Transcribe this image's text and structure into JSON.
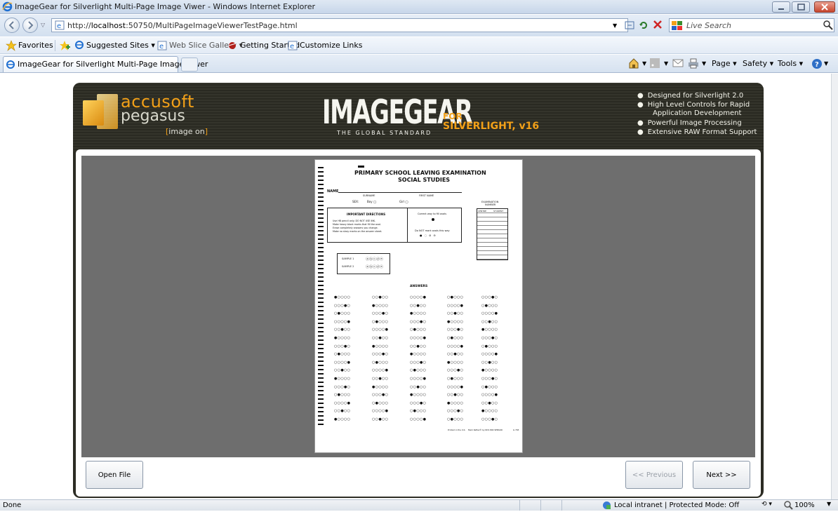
{
  "window": {
    "title": "ImageGear for Silverlight Multi-Page Image Viwer - Windows Internet Explorer"
  },
  "address_bar": {
    "url_prefix": "http://",
    "url_host": "localhost",
    "url_rest": ":50750/MultiPageImageViewerTestPage.html",
    "search_placeholder": "Live Search"
  },
  "favorites_bar": {
    "favorites": "Favorites",
    "suggested_sites": "Suggested Sites ▾",
    "web_slice_gallery": "Web Slice Gallery ▾",
    "getting_started": "Getting Started",
    "customize_links": "Customize Links"
  },
  "tab_bar": {
    "active_tab": "ImageGear for Silverlight Multi-Page Image Viwer",
    "page_menu": "Page ▾",
    "safety_menu": "Safety ▾",
    "tools_menu": "Tools ▾"
  },
  "banner": {
    "brand_accusoft": "accusoft",
    "brand_pegasus": "pegasus",
    "brand_tagline_open": "[",
    "brand_tagline": "image on",
    "brand_tagline_close": "]",
    "product": "IMAGEGEAR",
    "product_sub": "THE GLOBAL STANDARD",
    "for": "FOR",
    "platform": "SILVERLIGHT, v16",
    "features": [
      "Designed for Silverlight 2.0",
      "High Level Controls for Rapid",
      "Application Development",
      "Powerful Image Processing",
      "Extensive RAW Format Support"
    ]
  },
  "document": {
    "title1": "PRIMARY SCHOOL LEAVING EXAMINATION",
    "title2": "SOCIAL STUDIES",
    "name_label": "NAME",
    "surname_label": "SURNAME",
    "first_name_label": "FIRST NAME",
    "sex_label": "SEX:",
    "boy_label": "Boy ◯",
    "girl_label": "Girl ◯",
    "exam_number_1": "EXAMINATION",
    "exam_number_2": "NUMBER",
    "centre_label": "CENTRE",
    "student_label": "STUDENT",
    "directions_title": "IMPORTANT DIRECTIONS",
    "directions": [
      "Use HB pencil only. DO NOT USE INK.",
      "Make heavy black marks that fill the oval.",
      "Erase completely answers you change.",
      "Make no stray marks on the answer sheet."
    ],
    "correct_way": "Correct way to fill ovals",
    "do_not_mark": "Do NOT mark ovals this way",
    "sample1": "SAMPLE 1",
    "sample2": "SAMPLE 2",
    "answers_label": "ANSWERS",
    "footer_note": "Printed in the U.K.",
    "footer_mark": "Mark Reflex® by NCS 800 SENSOR",
    "footer_code": "G 765"
  },
  "controls": {
    "open_file": "Open File",
    "previous": "<< Previous",
    "next": "Next >>"
  },
  "status_bar": {
    "status": "Done",
    "zone": "Local intranet | Protected Mode: Off",
    "zoom": "100%"
  }
}
